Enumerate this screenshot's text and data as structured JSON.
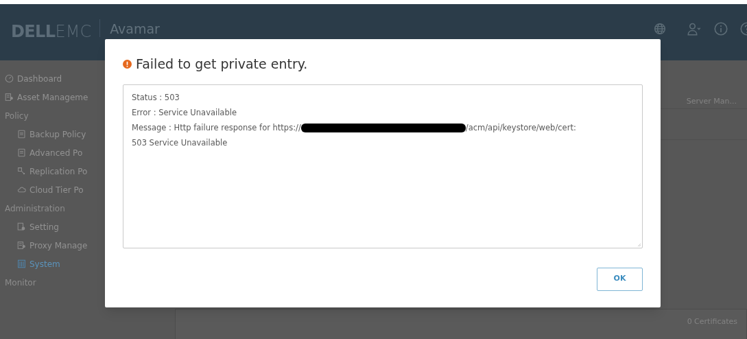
{
  "header": {
    "logo": {
      "brand": "DELL",
      "suffix": "EMC"
    },
    "product": "Avamar"
  },
  "sidebar": {
    "items": [
      {
        "kind": "item",
        "label": "Dashboard",
        "selected": false
      },
      {
        "kind": "item",
        "label": "Asset Manageme",
        "selected": false
      },
      {
        "kind": "section",
        "label": "Policy"
      },
      {
        "kind": "subitem",
        "label": "Backup Policy",
        "selected": false
      },
      {
        "kind": "subitem",
        "label": "Advanced Po",
        "selected": false
      },
      {
        "kind": "subitem",
        "label": "Replication Po",
        "selected": false
      },
      {
        "kind": "subitem",
        "label": "Cloud Tier Po",
        "selected": false
      },
      {
        "kind": "section",
        "label": "Administration"
      },
      {
        "kind": "subitem",
        "label": "Setting",
        "selected": false
      },
      {
        "kind": "subitem",
        "label": "Proxy Manage",
        "selected": false
      },
      {
        "kind": "subitem",
        "label": "System",
        "selected": true
      },
      {
        "kind": "section",
        "label": "Monitor"
      }
    ]
  },
  "background": {
    "column_label": "Server Man...",
    "footer_count": "0 Certificates"
  },
  "dialog": {
    "title": "Failed to get private entry.",
    "details": {
      "status": "Status : 503",
      "error": "Error : Service Unavailable",
      "message_start": "Message : Http failure response for https://",
      "message_redacted": true,
      "message_end": "/acm/api/keystore/web/cert:",
      "message_tail": "503 Service Unavailable"
    },
    "buttons": [
      "OK"
    ]
  }
}
